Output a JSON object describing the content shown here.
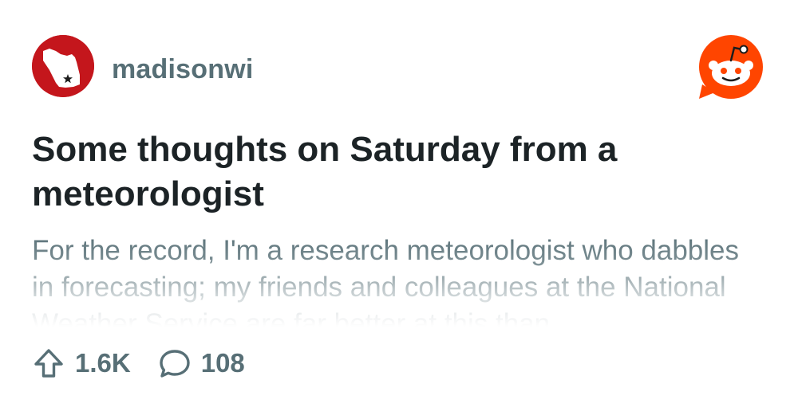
{
  "post": {
    "subreddit": "madisonwi",
    "title": "Some thoughts on Saturday from a meteorologist",
    "body": "For the record, I'm a research meteorologist who dabbles in forecasting; my friends and colleagues at the National Weather Service are far better at this than",
    "upvotes": "1.6K",
    "comments": "108"
  },
  "icons": {
    "avatar": "wisconsin-state-icon",
    "brand": "reddit-snoo-logo",
    "upvote": "upvote-arrow-icon",
    "comment": "comment-bubble-icon"
  },
  "colors": {
    "avatar_bg": "#c4161c",
    "brand_orange": "#ff4500",
    "muted_text": "#576f76",
    "title_text": "#1c2326"
  }
}
